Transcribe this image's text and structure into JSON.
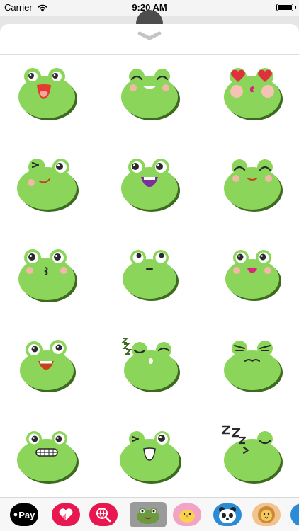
{
  "status_bar": {
    "carrier": "Carrier",
    "time": "9:20 AM",
    "battery_level": 1.0
  },
  "sheet": {
    "grabber_icon": "chevron-down-icon"
  },
  "stickers": [
    {
      "id": "laughing",
      "expression": "laughing-open-mouth"
    },
    {
      "id": "smiling-closed-eyes",
      "expression": "happy-closed-eyes"
    },
    {
      "id": "heart-eyes-kiss",
      "expression": "heart-eyes-kiss"
    },
    {
      "id": "winking-smirk",
      "expression": "wink-smirk"
    },
    {
      "id": "grinning",
      "expression": "grin-purple-mouth"
    },
    {
      "id": "content-smile",
      "expression": "closed-eyes-smile"
    },
    {
      "id": "kissing",
      "expression": "kiss"
    },
    {
      "id": "neutral",
      "expression": "neutral-flat"
    },
    {
      "id": "pink-lips",
      "expression": "pink-lips"
    },
    {
      "id": "happy-grin",
      "expression": "happy-grin"
    },
    {
      "id": "sleepy-yawn",
      "expression": "sleepy-zzz"
    },
    {
      "id": "annoyed",
      "expression": "annoyed"
    },
    {
      "id": "teeth-grimace",
      "expression": "grimace"
    },
    {
      "id": "wink-open-mouth",
      "expression": "wink-laugh"
    },
    {
      "id": "sleeping",
      "expression": "sleeping-zzz"
    }
  ],
  "app_drawer": {
    "apple_pay_label": "Pay",
    "apps": [
      {
        "name": "apple-pay-app",
        "icon": "apple-icon"
      },
      {
        "name": "digital-touch-app",
        "icon": "heart-hand-icon"
      },
      {
        "name": "web-search-app",
        "icon": "globe-search-icon"
      },
      {
        "name": "frog-sticker-app",
        "icon": "frog-icon",
        "selected": true
      },
      {
        "name": "chick-sticker-app",
        "icon": "chick-icon"
      },
      {
        "name": "panda-sticker-app",
        "icon": "panda-icon"
      },
      {
        "name": "lion-sticker-app",
        "icon": "lion-icon"
      },
      {
        "name": "more-app",
        "icon": "more-icon"
      }
    ]
  },
  "colors": {
    "frog_green": "#8bd65a",
    "frog_shadow": "#3d6a1f",
    "blush": "#f5b7a8",
    "heart_red": "#e0303c",
    "accent_pink": "#e8174f"
  }
}
